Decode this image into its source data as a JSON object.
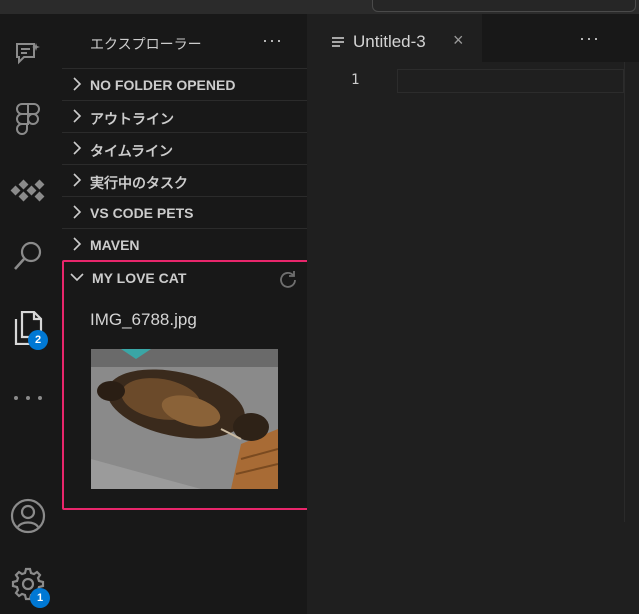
{
  "sidebar": {
    "title": "エクスプローラー",
    "more": "···",
    "sections": [
      {
        "label": "NO FOLDER OPENED"
      },
      {
        "label": "アウトライン"
      },
      {
        "label": "タイムライン"
      },
      {
        "label": "実行中のタスク"
      },
      {
        "label": "VS CODE PETS"
      },
      {
        "label": "MAVEN"
      },
      {
        "label": "MY LOVE CAT"
      }
    ],
    "cat_panel": {
      "filename": "IMG_6788.jpg"
    }
  },
  "activity": {
    "badges": {
      "explorer": "2",
      "settings": "1"
    },
    "icons": [
      "copilot-chat-icon",
      "figma-icon",
      "extensions-icon",
      "search-icon",
      "explorer-icon",
      "more-icon",
      "account-icon",
      "settings-gear-icon"
    ]
  },
  "editor": {
    "tab_label": "Untitled-3",
    "tab_close": "×",
    "more": "···",
    "line_number": "1"
  },
  "colors": {
    "accent": "#0078d4",
    "highlight_border": "#e8266b"
  }
}
